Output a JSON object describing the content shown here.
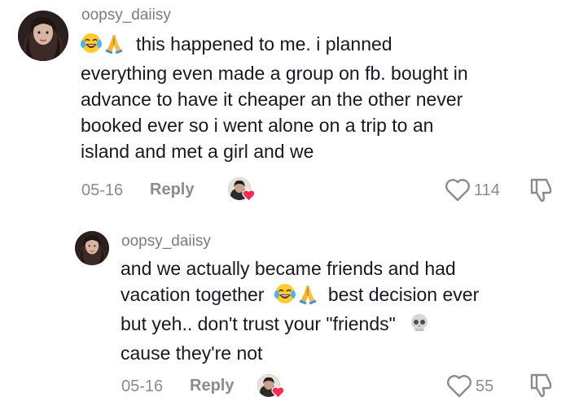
{
  "comments": [
    {
      "username": "oopsy_daiisy",
      "line1": "this happened to me. i planned",
      "line2": "everything even made a group on fb. bought in",
      "line3": "advance to have it cheaper an the other never",
      "line4": "booked ever so i went alone on a trip to an",
      "line5": "island and met a girl and we",
      "date": "05-16",
      "reply_label": "Reply",
      "likes": "114"
    },
    {
      "username": "oopsy_daiisy",
      "line1": "and we actually became friends and had",
      "line2a": "vacation together",
      "line2b": "best decision ever",
      "line3": "but yeh.. don't trust your \"friends\"",
      "line4": "cause they're not",
      "date": "05-16",
      "reply_label": "Reply",
      "likes": "55"
    }
  ],
  "icons": {
    "laugh": "face-with-tears-of-joy-icon",
    "pray": "folded-hands-icon",
    "skull": "skull-icon",
    "heart": "heart-outline-icon",
    "dislike": "thumbs-down-icon",
    "creator_like": "creator-liked-heart-icon"
  },
  "colors": {
    "text": "#161823",
    "muted": "#8a8b91",
    "creator_heart": "#fe2c55"
  }
}
